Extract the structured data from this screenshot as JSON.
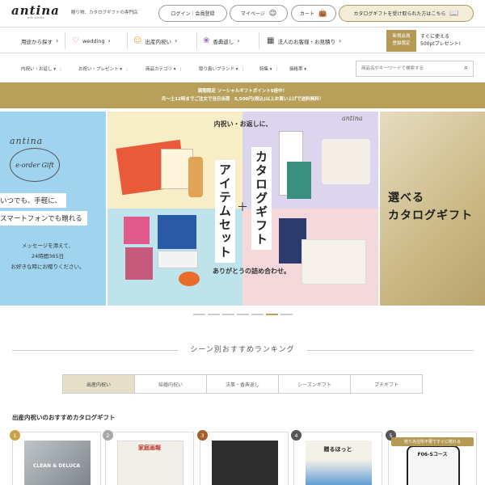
{
  "header": {
    "logo": "antina",
    "logo_sub": "gift studio",
    "tagline": "贈り物、カタログギフトの専門店",
    "login": "ログイン｜会員登録",
    "mypage": "マイページ",
    "cart": "カート",
    "received": "カタログギフトを受け取られた方はこちら"
  },
  "nav_primary": [
    {
      "label": "用途から探す",
      "icon": "none"
    },
    {
      "label": "wedding",
      "icon": "heart-icon"
    },
    {
      "label": "出産内祝い",
      "icon": "baby-icon"
    },
    {
      "label": "香典返し",
      "icon": "lotus-icon"
    },
    {
      "label": "法人のお客様・お見積り",
      "icon": "building-icon"
    }
  ],
  "member_badge": "新規会員\n登録限定",
  "member_promo": "すぐに使える\n500ptプレゼント!",
  "nav_secondary": [
    "内祝い・お返し",
    "お祝い・プレゼント",
    "商品カテゴリ",
    "取り扱いブランド",
    "特集",
    "価格帯"
  ],
  "search": {
    "placeholder": "商品名やキーワードで検索する"
  },
  "announcement": {
    "line1": "期間限定 ソーシャルギフトポイント5倍中！",
    "line2": "月～土12時までご注文で当日出荷　5,500円(税込)以上お買い上げで送料無料！"
  },
  "hero": {
    "left": {
      "brand": "antina",
      "eorder": "e-order Gift",
      "line1": "いつでも、手軽に、",
      "line2": "スマートフォンでも贈れる",
      "message": "メッセージを添えて、\n24時間365日\nお好きな時にお贈りください。"
    },
    "center": {
      "top": "内祝い・お返しに、",
      "brand": "antina",
      "vertical1": "アイテムセット",
      "plus": "＋",
      "vertical2": "カタログギフト",
      "bottom": "ありがとうの詰め合わせ。"
    },
    "right": {
      "title": "選べる\nカタログギフト"
    },
    "dots_total": 7,
    "dots_active": 5
  },
  "ranking": {
    "title": "シーン別おすすめランキング",
    "tabs": [
      "出産内祝い",
      "結婚内祝い",
      "法事・香典返し",
      "シーズンギフト",
      "プチギフト"
    ],
    "active_tab": 0,
    "section_title": "出産内祝いのおすすめカタログギフト",
    "products": [
      {
        "rank": "1",
        "badge_color": "#c9a247",
        "caption": "CLEAN & DELUCA"
      },
      {
        "rank": "2",
        "badge_color": "#a8a8a8",
        "caption": "家庭画報"
      },
      {
        "rank": "3",
        "badge_color": "#a65e2e",
        "caption": ""
      },
      {
        "rank": "4",
        "badge_color": "#555555",
        "caption": "贈るほっと"
      },
      {
        "rank": "5",
        "badge_color": "#555555",
        "caption": "F06-Sコース"
      }
    ],
    "product5_banner": "贈り先住所不要ですぐに贈れる"
  }
}
